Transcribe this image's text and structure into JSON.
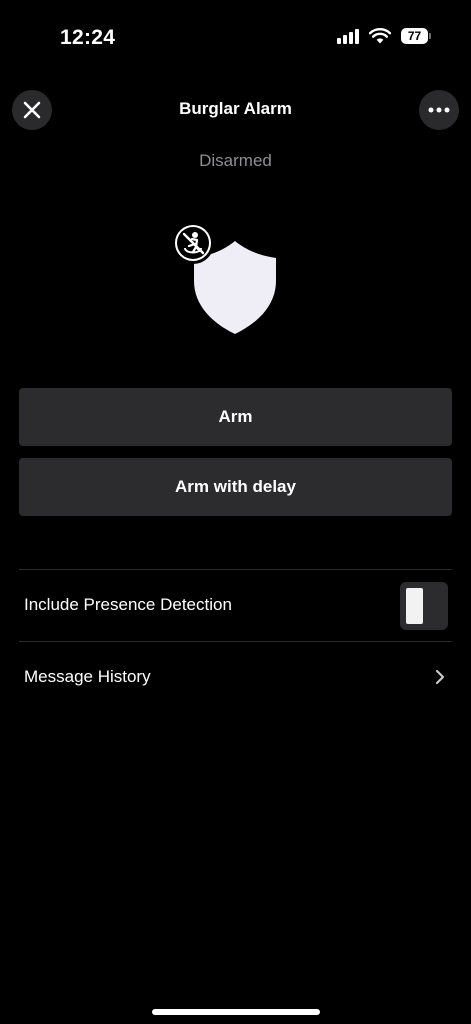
{
  "status_bar": {
    "time": "12:24",
    "battery_level": "77",
    "icons": [
      "signal-icon",
      "wifi-icon",
      "battery-icon"
    ]
  },
  "header": {
    "title": "Burglar Alarm",
    "close_icon": "close-icon",
    "more_icon": "more-icon"
  },
  "alarm": {
    "state": "Disarmed",
    "illustration": "shield-icon",
    "badge_icon": "presence-off-icon"
  },
  "actions": {
    "arm_label": "Arm",
    "arm_delay_label": "Arm with delay"
  },
  "settings": {
    "presence_label": "Include Presence Detection",
    "presence_enabled": false,
    "history_label": "Message History"
  },
  "colors": {
    "background": "#000000",
    "surface": "#2c2c2e",
    "secondary_text": "#8e8e93",
    "shield": "#efedf6"
  }
}
